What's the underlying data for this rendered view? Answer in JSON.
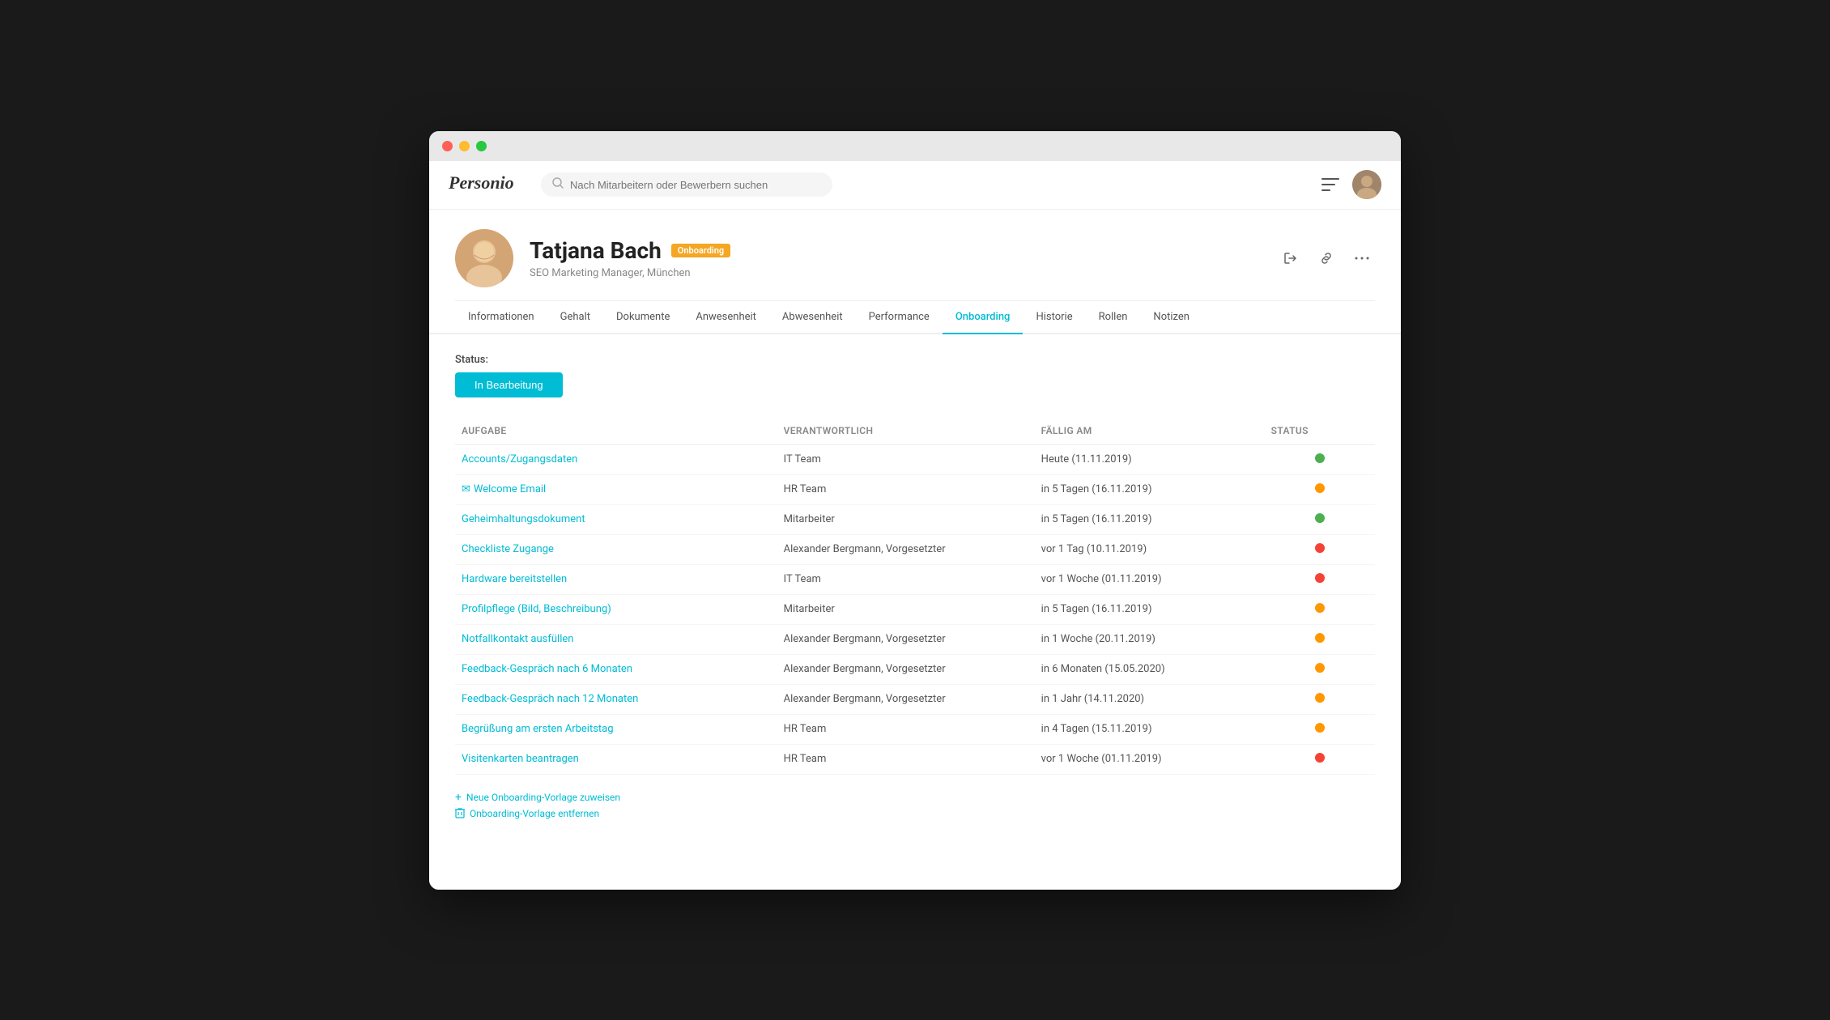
{
  "window": {
    "title": "Personio"
  },
  "topbar": {
    "logo": "Personio",
    "search_placeholder": "Nach Mitarbeitern oder Bewerbern suchen"
  },
  "profile": {
    "name": "Tatjana Bach",
    "badge": "Onboarding",
    "subtitle": "SEO Marketing Manager, München"
  },
  "nav": {
    "tabs": [
      {
        "label": "Informationen",
        "active": false
      },
      {
        "label": "Gehalt",
        "active": false
      },
      {
        "label": "Dokumente",
        "active": false
      },
      {
        "label": "Anwesenheit",
        "active": false
      },
      {
        "label": "Abwesenheit",
        "active": false
      },
      {
        "label": "Performance",
        "active": false
      },
      {
        "label": "Onboarding",
        "active": true
      },
      {
        "label": "Historie",
        "active": false
      },
      {
        "label": "Rollen",
        "active": false
      },
      {
        "label": "Notizen",
        "active": false
      }
    ]
  },
  "status": {
    "label": "Status:",
    "value": "In Bearbeitung"
  },
  "table": {
    "headers": {
      "task": "Aufgabe",
      "responsible": "Verantwortlich",
      "due": "Fällig am",
      "status": "Status"
    },
    "rows": [
      {
        "task": "Accounts/Zugangsdaten",
        "responsible": "IT Team",
        "due": "Heute (11.11.2019)",
        "status": "green",
        "has_icon": false
      },
      {
        "task": "Welcome Email",
        "responsible": "HR Team",
        "due": "in 5 Tagen (16.11.2019)",
        "status": "orange",
        "has_icon": true
      },
      {
        "task": "Geheimhaltungsdokument",
        "responsible": "Mitarbeiter",
        "due": "in 5 Tagen (16.11.2019)",
        "status": "green",
        "has_icon": false
      },
      {
        "task": "Checkliste Zugange",
        "responsible": "Alexander Bergmann, Vorgesetzter",
        "due": "vor 1 Tag (10.11.2019)",
        "status": "red",
        "has_icon": false
      },
      {
        "task": "Hardware bereitstellen",
        "responsible": "IT Team",
        "due": "vor 1 Woche (01.11.2019)",
        "status": "red",
        "has_icon": false
      },
      {
        "task": "Profilpflege (Bild, Beschreibung)",
        "responsible": "Mitarbeiter",
        "due": "in 5 Tagen (16.11.2019)",
        "status": "orange",
        "has_icon": false
      },
      {
        "task": "Notfallkontakt ausfüllen",
        "responsible": "Alexander Bergmann, Vorgesetzter",
        "due": "in 1 Woche (20.11.2019)",
        "status": "orange",
        "has_icon": false
      },
      {
        "task": "Feedback-Gespräch nach 6 Monaten",
        "responsible": "Alexander Bergmann, Vorgesetzter",
        "due": "in 6 Monaten (15.05.2020)",
        "status": "orange",
        "has_icon": false
      },
      {
        "task": "Feedback-Gespräch nach 12 Monaten",
        "responsible": "Alexander Bergmann, Vorgesetzter",
        "due": "in 1 Jahr (14.11.2020)",
        "status": "orange",
        "has_icon": false
      },
      {
        "task": "Begrüßung am ersten Arbeitstag",
        "responsible": "HR Team",
        "due": "in 4 Tagen (15.11.2019)",
        "status": "orange",
        "has_icon": false
      },
      {
        "task": "Visitenkarten beantragen",
        "responsible": "HR Team",
        "due": "vor 1 Woche (01.11.2019)",
        "status": "red",
        "has_icon": false
      }
    ]
  },
  "footer": {
    "link1": "Neue Onboarding-Vorlage zuweisen",
    "link2": "Onboarding-Vorlage entfernen"
  }
}
